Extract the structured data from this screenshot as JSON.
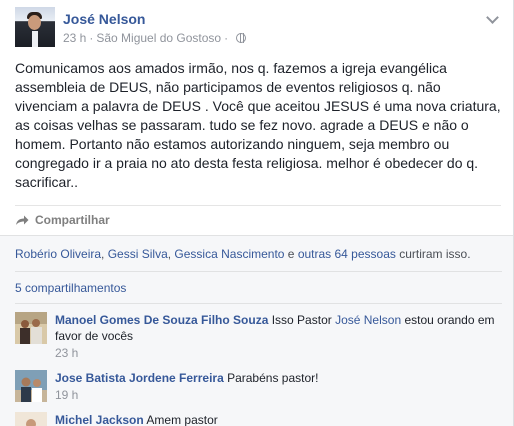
{
  "post": {
    "author": "José Nelson",
    "time": "23 h",
    "separator": "·",
    "location": "São Miguel do Gostoso",
    "text": "Comunicamos aos amados irmão, nos q. fazemos a igreja evangélica assembleia de DEUS, não participamos de eventos religiosos q. não vivenciam a palavra de DEUS . Você que aceitou JESUS é uma nova criatura, as coisas velhas se passaram. tudo se fez novo. agrade a DEUS e não o homem. Portanto não estamos autorizando ninguem, seja membro ou congregado ir a praia no ato desta festa religiosa. melhor é obedecer do q. sacrificar.."
  },
  "actions": {
    "share_label": "Compartilhar"
  },
  "likes": {
    "names": [
      "Robério Oliveira",
      "Gessi Silva",
      "Gessica Nascimento"
    ],
    "sep1": ", ",
    "sep2": ", ",
    "and_text": " e ",
    "others_link": "outras 64 pessoas",
    "suffix": " curtiram isso."
  },
  "shares_label": "5 compartilhamentos",
  "comments": [
    {
      "author": "Manoel Gomes De Souza Filho Souza",
      "text_before": " Isso Pastor ",
      "mention": "José Nelson",
      "text_after": " estou orando em favor de vocês",
      "time": "23 h"
    },
    {
      "author": "Jose Batista Jordene Ferreira",
      "text": " Parabéns pastor!",
      "time": "19 h"
    },
    {
      "author": "Michel Jackson",
      "text": " Amem pastor"
    }
  ],
  "colors": {
    "link": "#365899",
    "meta": "#90949c",
    "feedback_bg": "#f6f7f9"
  }
}
